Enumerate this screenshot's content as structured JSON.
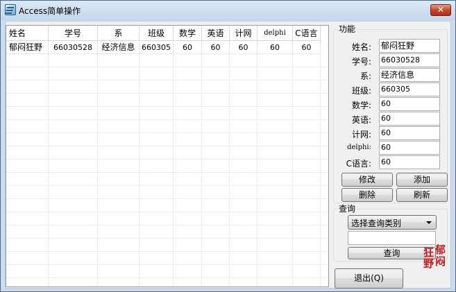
{
  "window": {
    "title": "Access简单操作",
    "close_glyph": "✕"
  },
  "grid": {
    "columns": [
      {
        "label": "姓名"
      },
      {
        "label": "学号"
      },
      {
        "label": "系"
      },
      {
        "label": "班级"
      },
      {
        "label": "数学"
      },
      {
        "label": "英语"
      },
      {
        "label": "计网"
      },
      {
        "label": "delphi"
      },
      {
        "label": "C语言"
      }
    ],
    "rows": [
      [
        "郁闷狂野",
        "66030528",
        "经济信息",
        "660305",
        "60",
        "60",
        "60",
        "60",
        "60"
      ]
    ]
  },
  "function_group": {
    "title": "功能",
    "fields": {
      "name": {
        "label": "姓名:",
        "value": "郁闷狂野"
      },
      "id": {
        "label": "学号:",
        "value": "66030528"
      },
      "dept": {
        "label": "系:",
        "value": "经济信息"
      },
      "class": {
        "label": "班级:",
        "value": "660305"
      },
      "math": {
        "label": "数学:",
        "value": "60"
      },
      "english": {
        "label": "英语:",
        "value": "60"
      },
      "network": {
        "label": "计网:",
        "value": "60"
      },
      "delphi": {
        "label": "delphi:",
        "value": "60"
      },
      "clang": {
        "label": "C语言:",
        "value": "60"
      }
    },
    "buttons": {
      "modify": "修改",
      "add": "添加",
      "delete": "删除",
      "refresh": "刷新"
    }
  },
  "query_group": {
    "title": "查询",
    "combo_selected": "选择查询类别",
    "input_value": "",
    "search_button": "查询"
  },
  "exit_button": "退出(Q)",
  "logo_text": [
    "郁",
    "闷",
    "狂",
    "野"
  ],
  "colors": {
    "titlebar": "#cbdcee",
    "close": "#c44a2c",
    "logo": "#c8191c"
  }
}
